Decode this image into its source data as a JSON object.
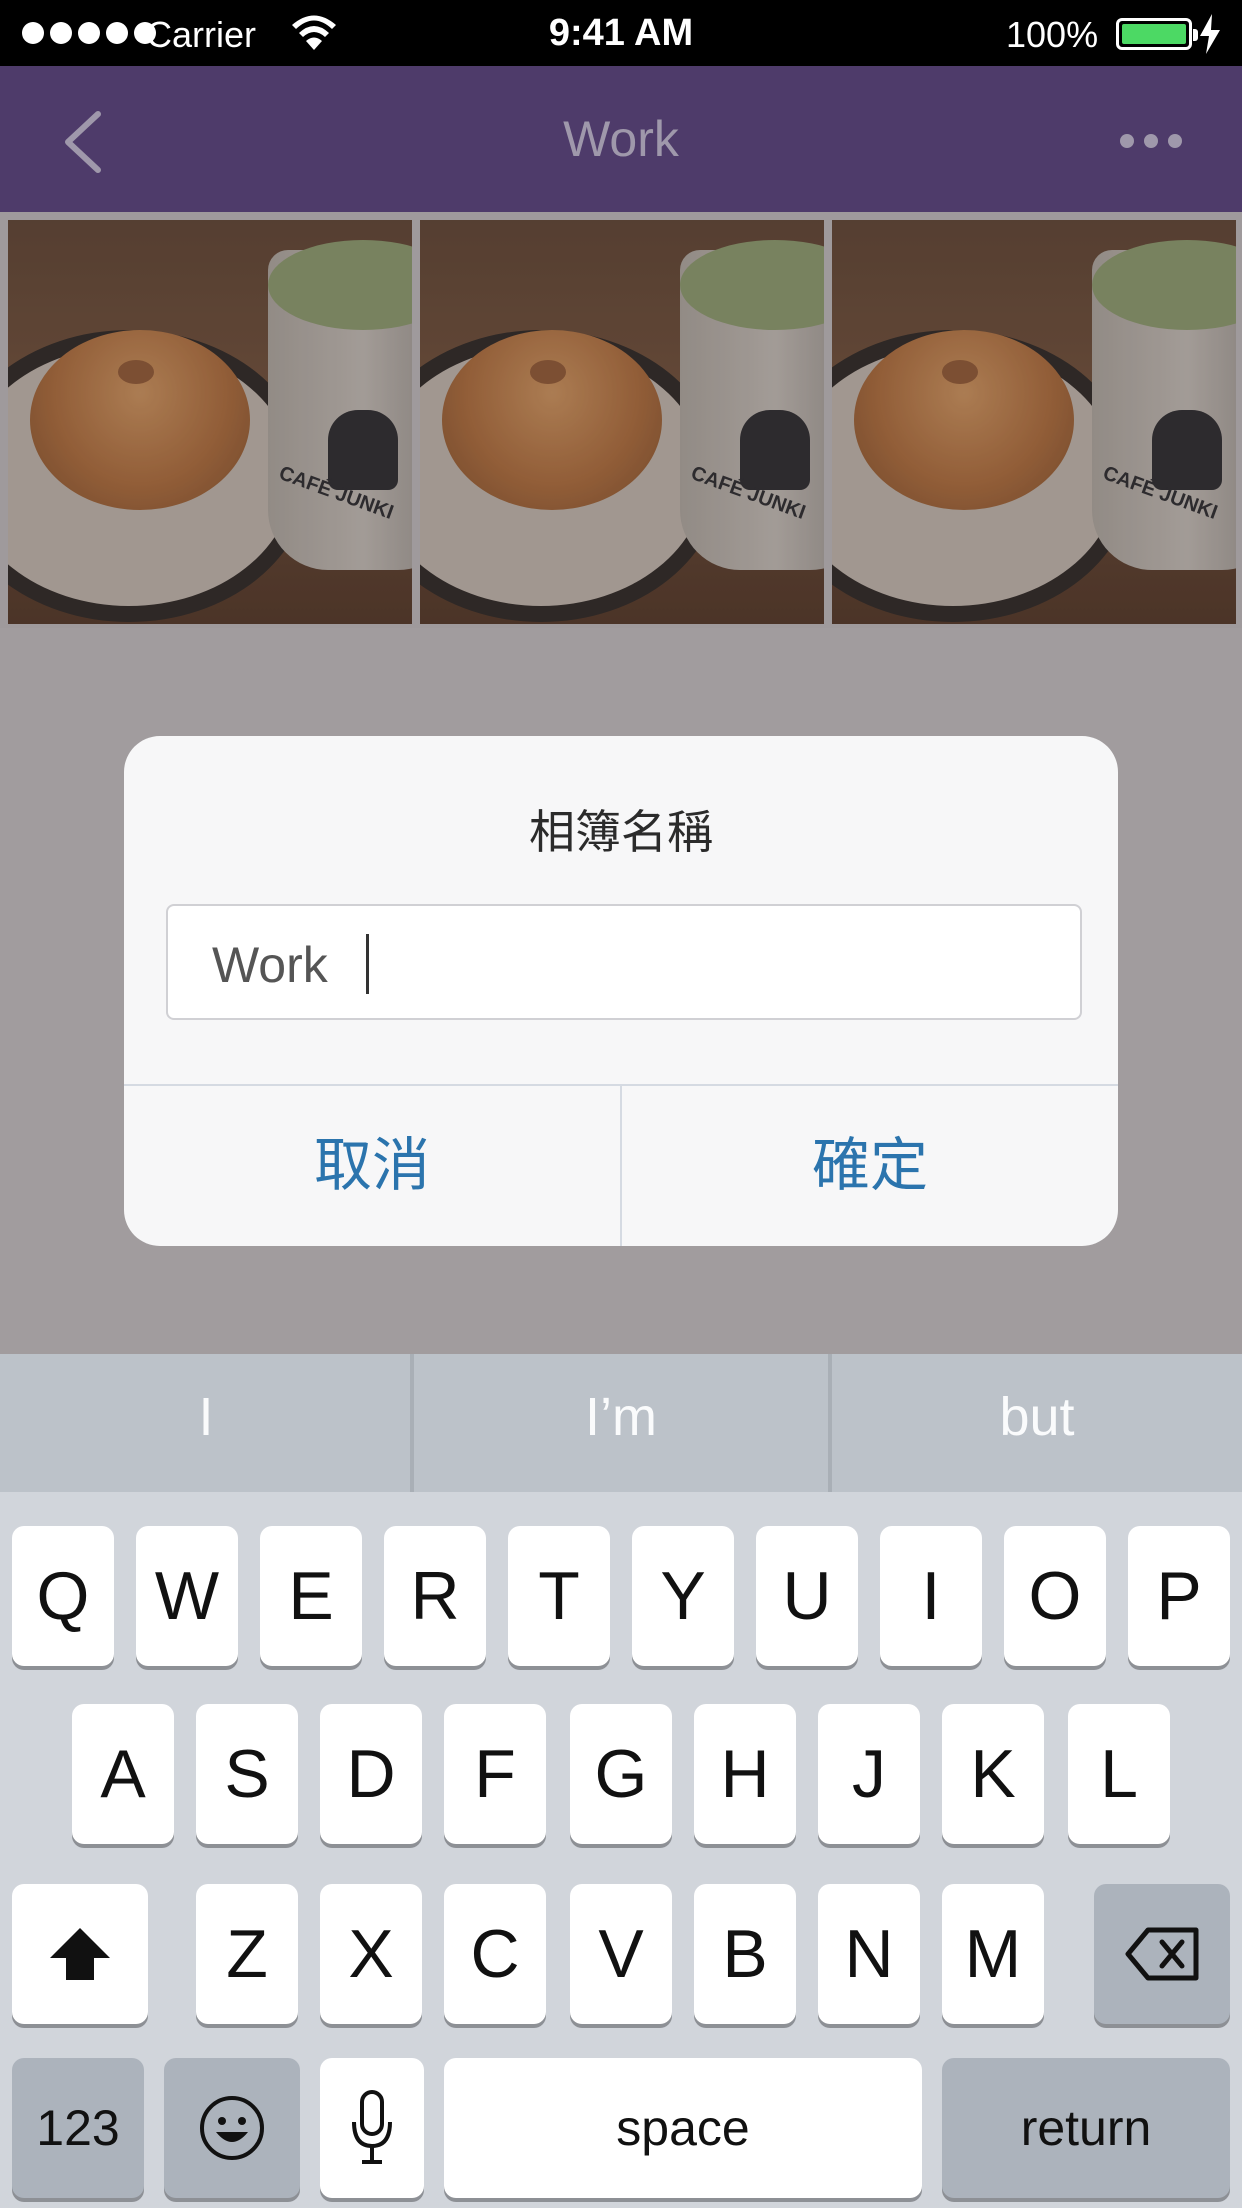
{
  "status_bar": {
    "carrier": "Carrier",
    "time": "9:41 AM",
    "battery": "100%"
  },
  "nav": {
    "title": "Work"
  },
  "photos": [
    {
      "logo_text": "CAFÉ JUNKI"
    },
    {
      "logo_text": "CAFÉ JUNKI"
    },
    {
      "logo_text": "CAFÉ JUNKI"
    }
  ],
  "dialog": {
    "title": "相簿名稱",
    "input_value": "Work",
    "cancel_label": "取消",
    "confirm_label": "確定"
  },
  "keyboard": {
    "suggestions": [
      "I",
      "I’m",
      "but"
    ],
    "row1": [
      "Q",
      "W",
      "E",
      "R",
      "T",
      "Y",
      "U",
      "I",
      "O",
      "P"
    ],
    "row2": [
      "A",
      "S",
      "D",
      "F",
      "G",
      "H",
      "J",
      "K",
      "L"
    ],
    "row3": [
      "Z",
      "X",
      "C",
      "V",
      "B",
      "N",
      "M"
    ],
    "numbers_label": "123",
    "space_label": "space",
    "return_label": "return"
  },
  "colors": {
    "nav_background": "#4e3b6a",
    "button_text": "#2b74ad",
    "battery_fill": "#4cd964"
  }
}
